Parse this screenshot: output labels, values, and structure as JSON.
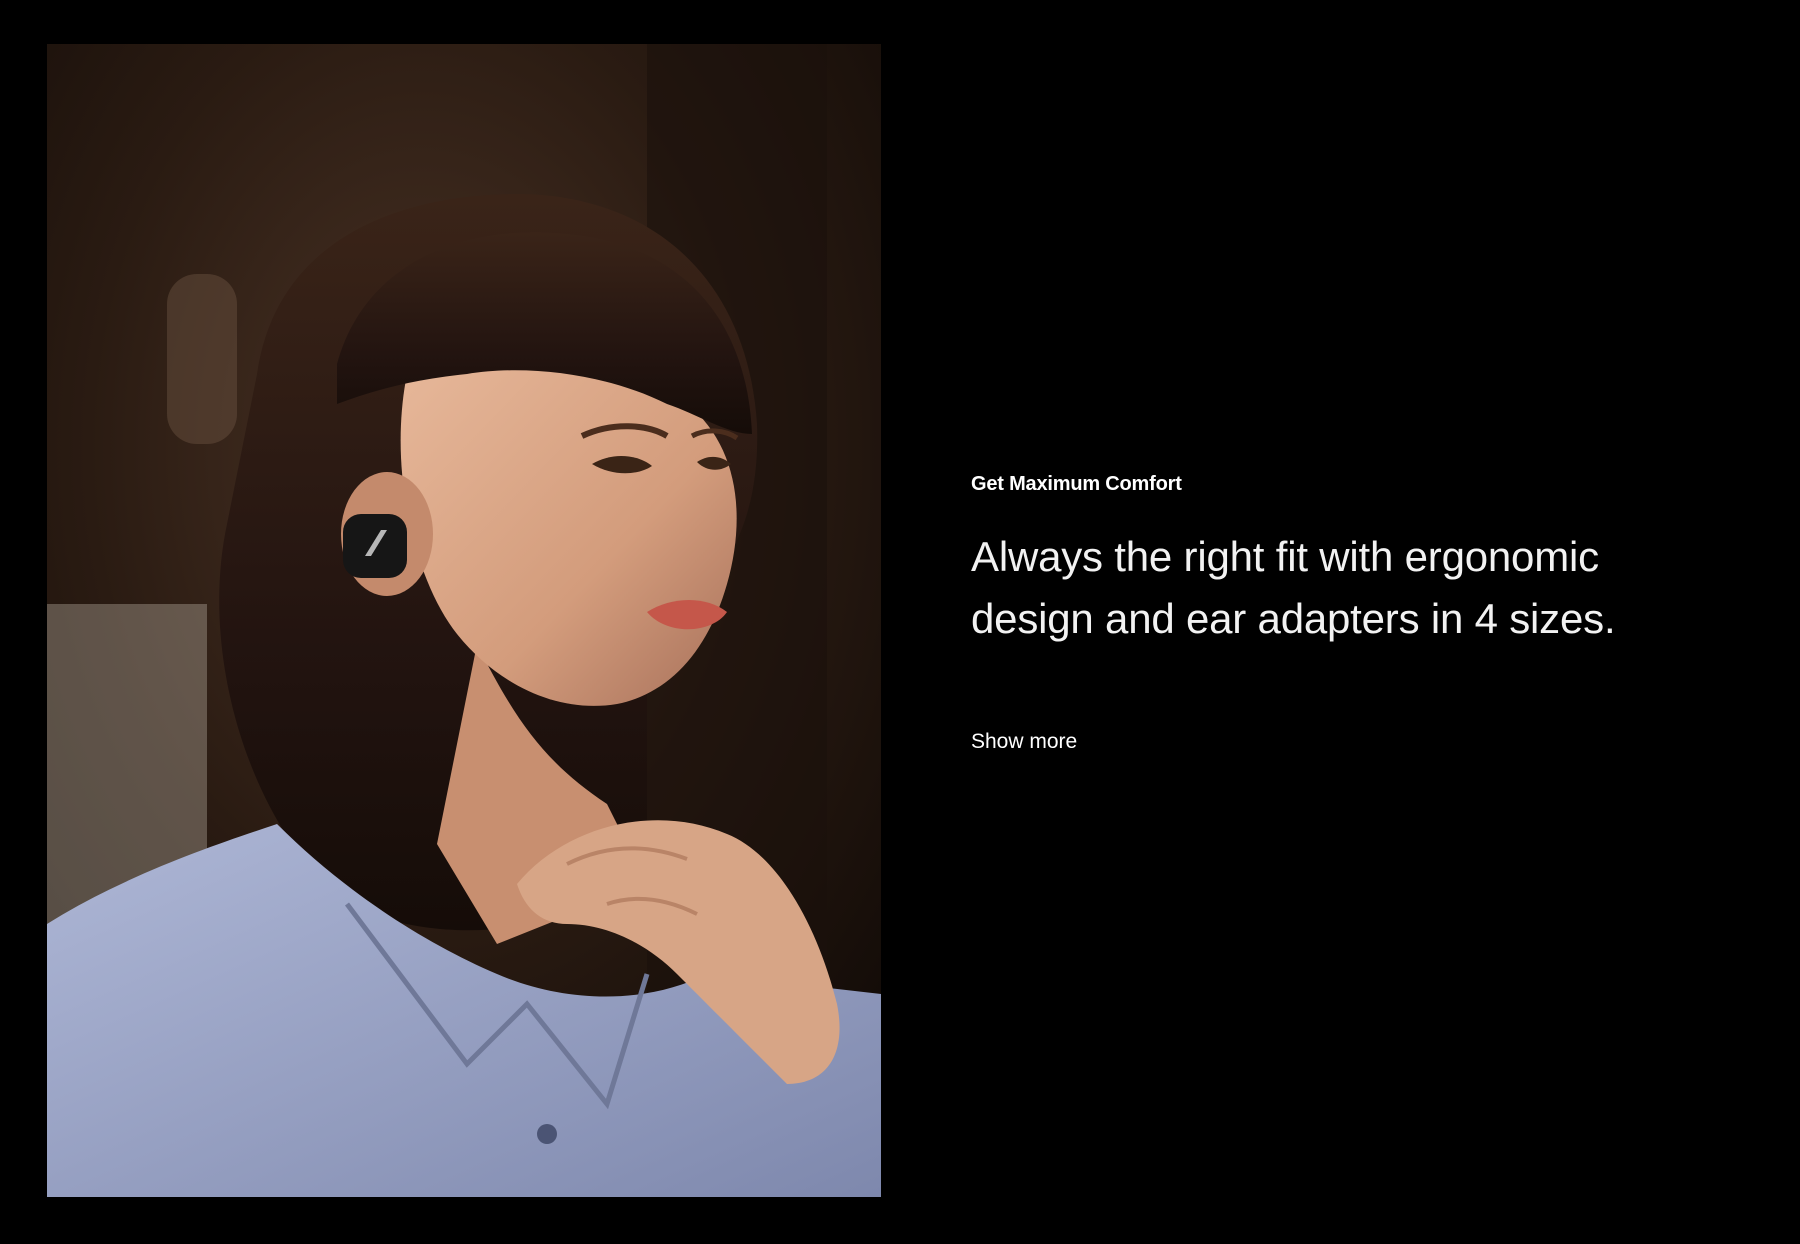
{
  "feature": {
    "eyebrow": "Get Maximum Comfort",
    "headline_line1": "Always the right fit with ergonomic",
    "headline_line2": "design and ear adapters in 4 sizes.",
    "link_label": "Show more"
  },
  "image": {
    "alt": "Woman wearing a black wireless earbud, resting her chin on her hand",
    "logo_icon": "sennheiser-logo-icon"
  },
  "colors": {
    "background": "#000000",
    "text": "#ffffff"
  }
}
